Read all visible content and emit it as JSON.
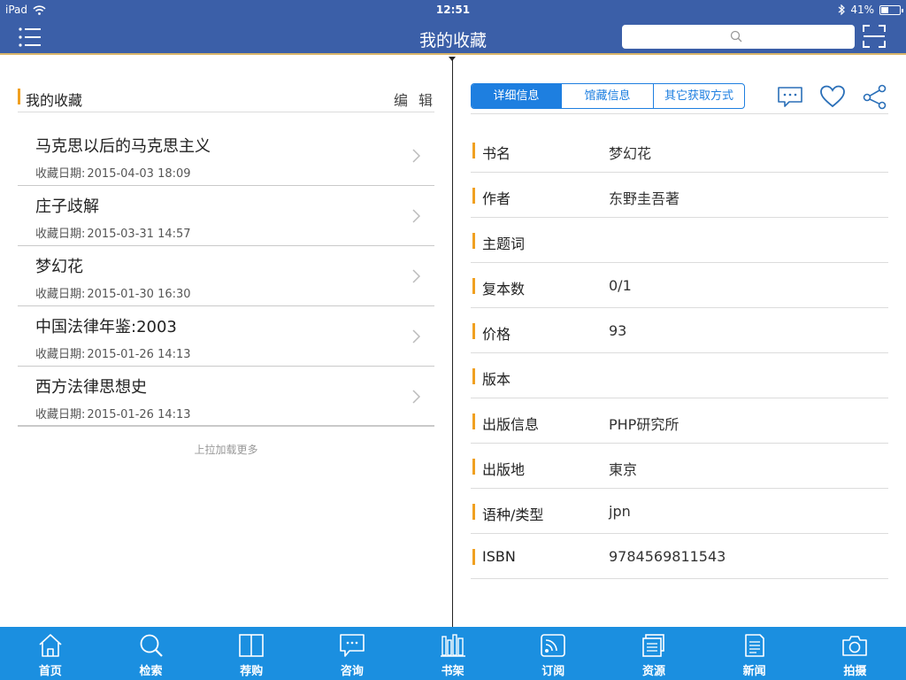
{
  "status": {
    "device": "iPad",
    "time": "12:51",
    "battery": "41%",
    "battery_level": 0.41
  },
  "nav": {
    "title": "我的收藏",
    "search_placeholder": ""
  },
  "favorites": {
    "header": "我的收藏",
    "edit_label": "编辑",
    "date_label": "收藏日期:",
    "items": [
      {
        "title": "马克思以后的马克思主义",
        "date": "2015-04-03 18:09"
      },
      {
        "title": "庄子歧解",
        "date": "2015-03-31 14:57"
      },
      {
        "title": "梦幻花",
        "date": "2015-01-30 16:30"
      },
      {
        "title": "中国法律年鉴:2003",
        "date": "2015-01-26 14:13"
      },
      {
        "title": "西方法律思想史",
        "date": "2015-01-26 14:13"
      }
    ],
    "load_more": "上拉加载更多"
  },
  "detail": {
    "tabs": [
      "详细信息",
      "馆藏信息",
      "其它获取方式"
    ],
    "active_tab": 0,
    "rows": [
      {
        "key": "书名",
        "value": "梦幻花"
      },
      {
        "key": "作者",
        "value": "东野圭吾著"
      },
      {
        "key": "主题词",
        "value": ""
      },
      {
        "key": "复本数",
        "value": "0/1"
      },
      {
        "key": "价格",
        "value": "93"
      },
      {
        "key": "版本",
        "value": ""
      },
      {
        "key": "出版信息",
        "value": "PHP研究所"
      },
      {
        "key": "出版地",
        "value": "東京"
      },
      {
        "key": "语种/类型",
        "value": "jpn"
      },
      {
        "key": "ISBN",
        "value": "9784569811543"
      }
    ]
  },
  "tabbar": {
    "items": [
      {
        "label": "首页",
        "icon": "home-icon"
      },
      {
        "label": "检索",
        "icon": "search-icon"
      },
      {
        "label": "荐购",
        "icon": "book-icon"
      },
      {
        "label": "咨询",
        "icon": "chat-icon"
      },
      {
        "label": "书架",
        "icon": "bookshelf-icon"
      },
      {
        "label": "订阅",
        "icon": "rss-icon"
      },
      {
        "label": "资源",
        "icon": "resources-icon"
      },
      {
        "label": "新闻",
        "icon": "news-icon"
      },
      {
        "label": "拍摄",
        "icon": "camera-icon"
      }
    ]
  },
  "colors": {
    "nav_bg": "#3b5fa8",
    "accent": "#1e7fe0",
    "tabbar_bg": "#1b8fe0",
    "marker": "#f0a020"
  }
}
